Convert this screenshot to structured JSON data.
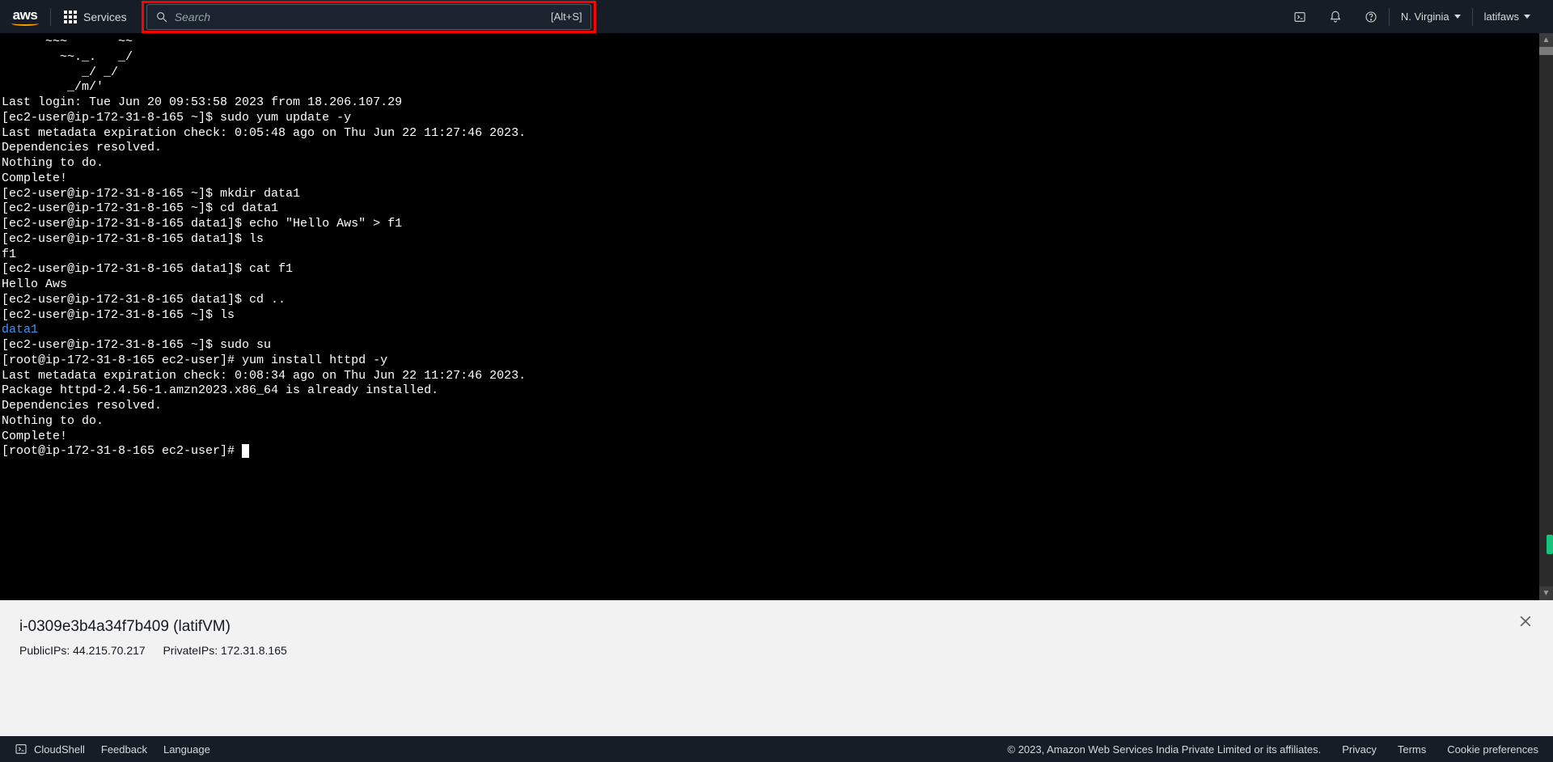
{
  "topnav": {
    "logo_text": "aws",
    "services_label": "Services",
    "search_placeholder": "Search",
    "search_hint": "[Alt+S]",
    "region": "N. Virginia",
    "account": "latifaws"
  },
  "terminal": {
    "ascii1": "      ~~~       ~~",
    "ascii2": "        ~~._.   _/",
    "ascii3": "           _/ _/",
    "ascii4": "         _/m/'",
    "lines": [
      "Last login: Tue Jun 20 09:53:58 2023 from 18.206.107.29",
      "[ec2-user@ip-172-31-8-165 ~]$ sudo yum update -y",
      "Last metadata expiration check: 0:05:48 ago on Thu Jun 22 11:27:46 2023.",
      "Dependencies resolved.",
      "Nothing to do.",
      "Complete!",
      "[ec2-user@ip-172-31-8-165 ~]$ mkdir data1",
      "[ec2-user@ip-172-31-8-165 ~]$ cd data1",
      "[ec2-user@ip-172-31-8-165 data1]$ echo \"Hello Aws\" > f1",
      "[ec2-user@ip-172-31-8-165 data1]$ ls",
      "f1",
      "[ec2-user@ip-172-31-8-165 data1]$ cat f1",
      "Hello Aws",
      "[ec2-user@ip-172-31-8-165 data1]$ cd ..",
      "[ec2-user@ip-172-31-8-165 ~]$ ls"
    ],
    "dir_output": "data1",
    "lines2": [
      "[ec2-user@ip-172-31-8-165 ~]$ sudo su",
      "[root@ip-172-31-8-165 ec2-user]# yum install httpd -y",
      "Last metadata expiration check: 0:08:34 ago on Thu Jun 22 11:27:46 2023.",
      "Package httpd-2.4.56-1.amzn2023.x86_64 is already installed.",
      "Dependencies resolved.",
      "Nothing to do.",
      "Complete!"
    ],
    "prompt": "[root@ip-172-31-8-165 ec2-user]# "
  },
  "info": {
    "title": "i-0309e3b4a34f7b409 (latifVM)",
    "public_label": "PublicIPs:",
    "public_ip": "44.215.70.217",
    "private_label": "PrivateIPs:",
    "private_ip": "172.31.8.165"
  },
  "bottombar": {
    "cloudshell": "CloudShell",
    "feedback": "Feedback",
    "language": "Language",
    "copyright": "© 2023, Amazon Web Services India Private Limited or its affiliates.",
    "privacy": "Privacy",
    "terms": "Terms",
    "cookies": "Cookie preferences"
  }
}
